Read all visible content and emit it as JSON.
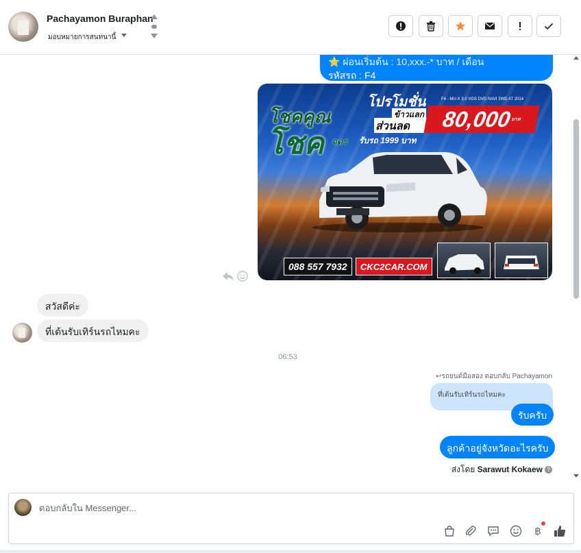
{
  "header": {
    "contact_name": "Pachayamon Buraphan",
    "assign_label": "มอบหมายการสนทนานี้",
    "toolbar": [
      {
        "name": "spam-button",
        "icon": "exclamation-circle-icon"
      },
      {
        "name": "delete-button",
        "icon": "trash-icon"
      },
      {
        "name": "star-button",
        "icon": "star-icon"
      },
      {
        "name": "unread-button",
        "icon": "envelope-icon"
      },
      {
        "name": "important-button",
        "icon": "exclamation-icon"
      },
      {
        "name": "done-button",
        "icon": "check-icon"
      }
    ],
    "star_color": "#f7923b"
  },
  "conversation": {
    "top_bubble": {
      "line1": "⭐ ผ่อนเริ่มต้น : 10,xxx.-* บาท / เดือน",
      "line2": "รหัสรถ : F4"
    },
    "promo": {
      "promo_title": "โปรโมชั่น",
      "model": "F4 - MU-X 3.0 VGS DVD NAVI 2WD AT 2014",
      "trade_label": "ข้าวแลก",
      "discount_label": "ส่วนลด",
      "discount_value": "80,000",
      "currency": "บาท",
      "headline1": "โชคคูณ",
      "headline2": "โชค",
      "down_prefix": "จดร",
      "down_text": "รับรถ 1999 บาท",
      "phone": "088 557 7932",
      "website": "CKC2CAR.COM"
    },
    "incoming": [
      {
        "text": "สวัสดีค่ะ"
      },
      {
        "text": "ที่เต้นรับเทิร์นรถไหมคะ"
      }
    ],
    "time": "06:53",
    "reply_meta": "รถยนต์มือสอง ตอบกลับ Pachayamon",
    "quoted_text": "ที่เต้นรับเทิร์นรถไหมคะ",
    "outgoing": [
      {
        "text": "รับครับ"
      },
      {
        "text": "ลูกค้าอยู่จังหวัดอะไรครับ"
      }
    ],
    "sent_by_label": "ส่งโดย",
    "sent_by_name": "Sarawut Kokaew",
    "bubble_color": "#0084ff"
  },
  "composer": {
    "placeholder": "ตอบกลับใน Messenger...",
    "icons": [
      "shopping-bag-icon",
      "paperclip-icon",
      "saved-reply-icon",
      "emoji-icon",
      "baht-payment-icon",
      "like-thumb-icon"
    ]
  }
}
